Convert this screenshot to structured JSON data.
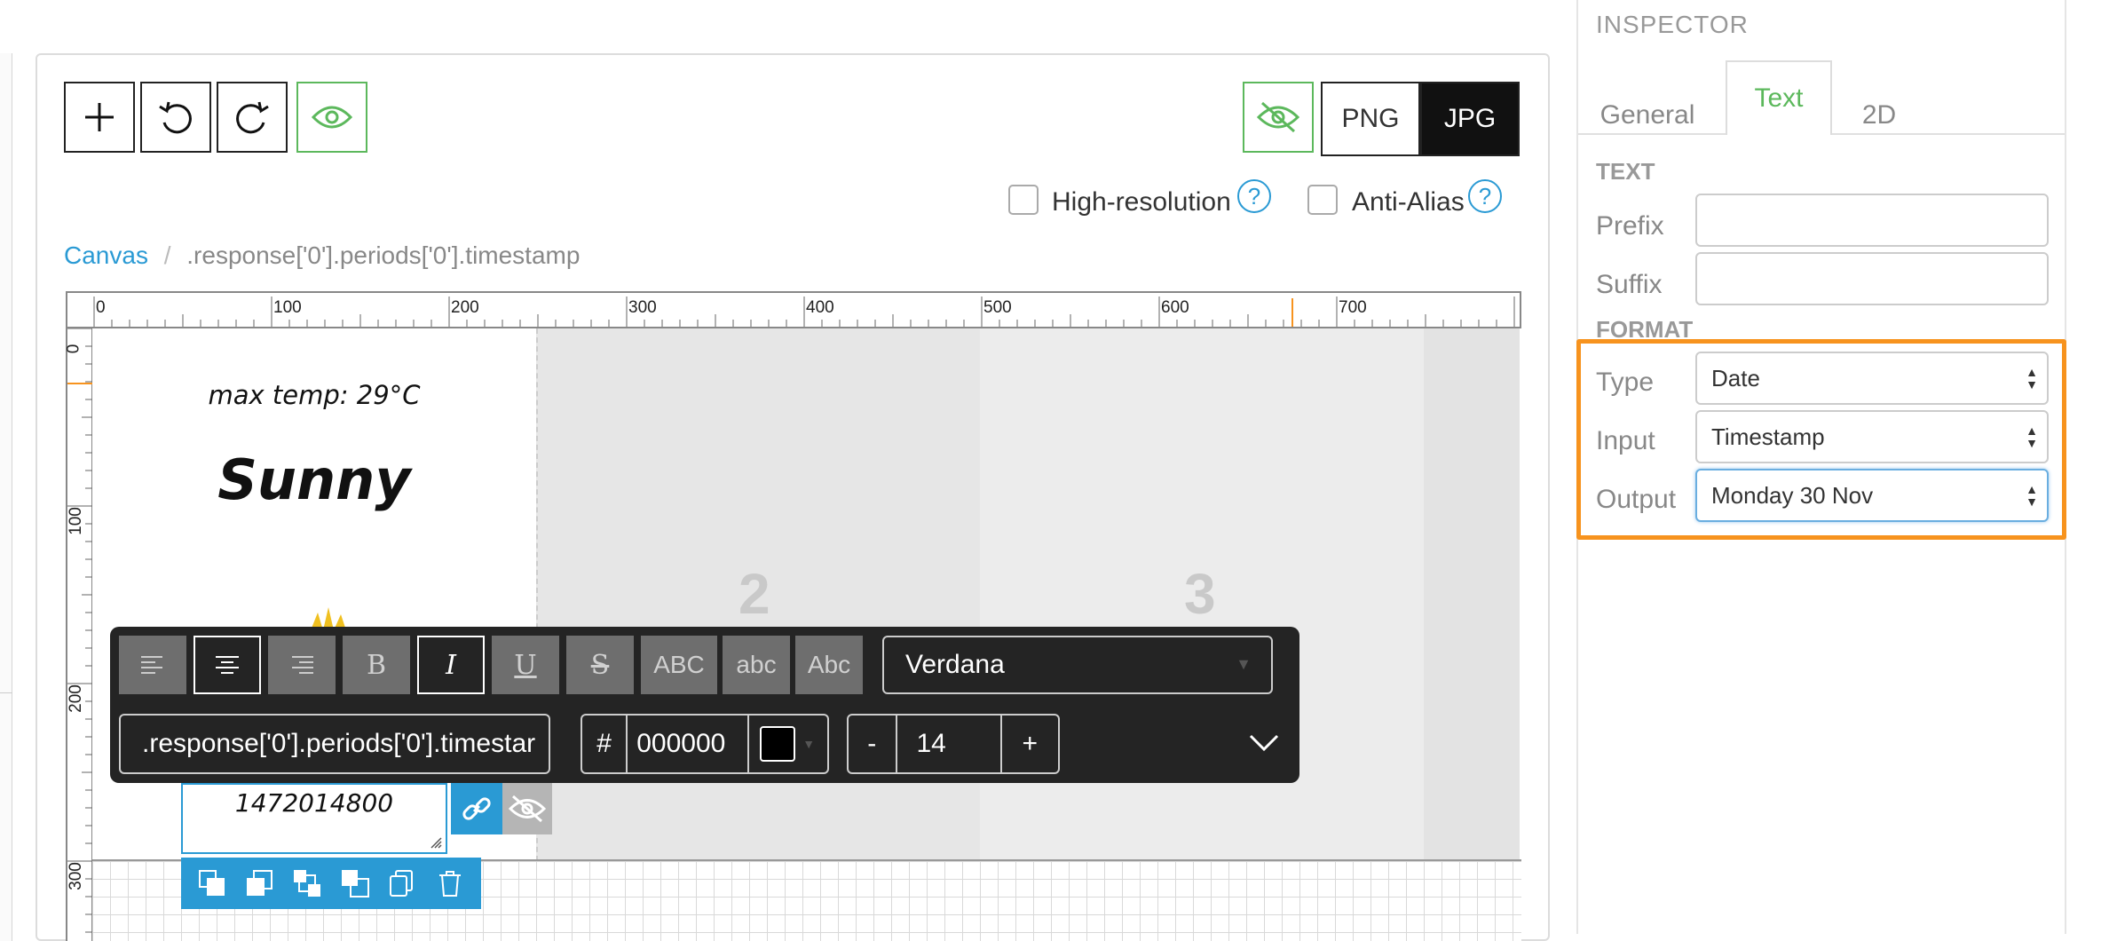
{
  "toolbar": {
    "add_icon": "plus-icon",
    "undo_icon": "undo-icon",
    "redo_icon": "redo-icon",
    "preview_icon": "eye-icon",
    "hide_icon": "eye-slash-icon",
    "formats": [
      "PNG",
      "JPG"
    ],
    "selected_format": "JPG",
    "high_resolution_label": "High-resolution",
    "anti_alias_label": "Anti-Alias",
    "help_glyph": "?"
  },
  "breadcrumb": {
    "root": "Canvas",
    "separator": "/",
    "current": ".response['0'].periods['0'].timestamp"
  },
  "ruler": {
    "top_labels": [
      "0",
      "100",
      "200",
      "300",
      "400",
      "500",
      "600",
      "700"
    ],
    "left_labels": [
      "0",
      "100",
      "200",
      "300"
    ]
  },
  "canvas": {
    "max_temp_text": "max temp: 29°C",
    "condition_text": "Sunny",
    "cell_numbers": [
      "2",
      "3"
    ],
    "selected_text_value": "1472014800"
  },
  "text_toolbar": {
    "case_buttons": [
      "ABC",
      "abc",
      "Abc"
    ],
    "bold_glyph": "B",
    "italic_glyph": "I",
    "underline_glyph": "U",
    "strike_glyph": "S",
    "font": "Verdana",
    "binding_path": ".response['0'].periods['0'].timestar",
    "hash": "#",
    "color_hex": "000000",
    "color_swatch": "#000000",
    "minus": "-",
    "font_size": "14",
    "plus": "+"
  },
  "inspector": {
    "title": "INSPECTOR",
    "tabs": [
      "General",
      "Text",
      "2D"
    ],
    "active_tab": "Text",
    "text_section": "TEXT",
    "prefix_label": "Prefix",
    "prefix_value": "",
    "suffix_label": "Suffix",
    "suffix_value": "",
    "format_section": "FORMAT",
    "type_label": "Type",
    "type_value": "Date",
    "input_label": "Input",
    "input_value": "Timestamp",
    "output_label": "Output",
    "output_value": "Monday 30 Nov"
  },
  "colors": {
    "accent_green": "#5cb85c",
    "link_blue": "#2a9ad4",
    "highlight_orange": "#f7931e"
  }
}
